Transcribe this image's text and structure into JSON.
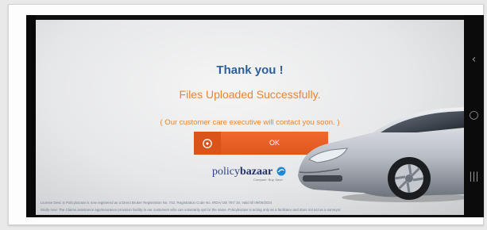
{
  "dialog": {
    "title": "Thank you !",
    "message": "Files Uploaded Successfully.",
    "note": "( Our customer care executive will contact you soon. )",
    "ok_label": "OK",
    "ok_icon": "power-icon"
  },
  "brand": {
    "name_part1": "policy",
    "name_part2": "bazaar",
    "tagline": "Compare. Buy. Save."
  },
  "footer": {
    "line1": "License Desc is Policybazaar is now registered as a Direct Broker Registration No. 742, Registration Code No. IRDA/ DB 797/ 19, Valid till 09/06/2024",
    "line2": "Study now: The Claims assistance app/Insurance provision facility to our customers who can voluntarily opt for the same. Policybazaar is acting only as a facilitator and does not act as a surveyor."
  },
  "navigation": {
    "back_icon": "back-chevron-icon",
    "home_icon": "home-circle-icon",
    "recent_icon": "recent-apps-icon"
  },
  "colors": {
    "title": "#2e5f96",
    "accent": "#e9842e",
    "button": "#e9602a",
    "brand": "#2b3f8a"
  }
}
